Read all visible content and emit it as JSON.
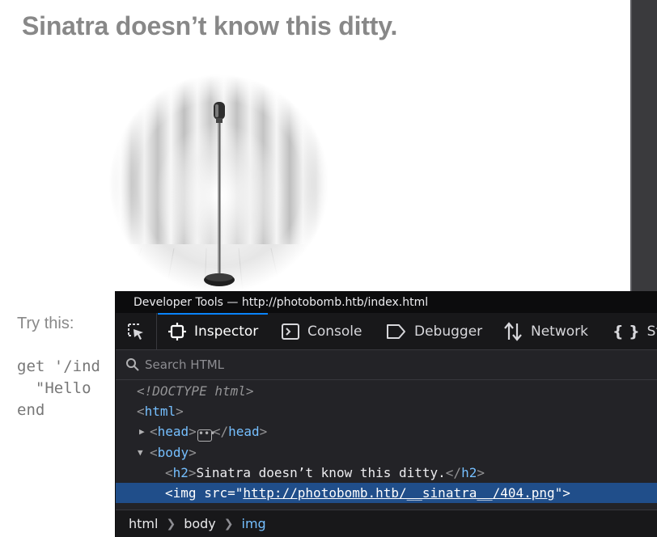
{
  "page": {
    "heading": "Sinatra doesn’t know this ditty.",
    "try_label": "Try this:",
    "code_lines": [
      "get '/ind",
      "  \"Hello ",
      "end"
    ]
  },
  "devtools": {
    "title": "Developer Tools — http://photobomb.htb/index.html",
    "tabs": [
      {
        "label": "Inspector",
        "icon": "inspector-icon",
        "active": true
      },
      {
        "label": "Console",
        "icon": "console-icon"
      },
      {
        "label": "Debugger",
        "icon": "debugger-icon"
      },
      {
        "label": "Network",
        "icon": "network-icon"
      },
      {
        "label": "Sty",
        "icon": "style-editor-icon"
      }
    ],
    "search_placeholder": "Search HTML",
    "tree": {
      "doctype": "<!DOCTYPE html>",
      "html_tag": "html",
      "head_tag": "head",
      "body_tag": "body",
      "h2_tag": "h2",
      "h2_text": "Sinatra doesn’t know this ditty.",
      "img_tag": "img",
      "img_attr": "src",
      "img_src": "http://photobomb.htb/__sinatra__/404.png"
    },
    "breadcrumbs": [
      "html",
      "body",
      "img"
    ],
    "colors": {
      "accent": "#0a84ff",
      "selected_row": "#204e8a",
      "tag": "#75bfff"
    }
  }
}
